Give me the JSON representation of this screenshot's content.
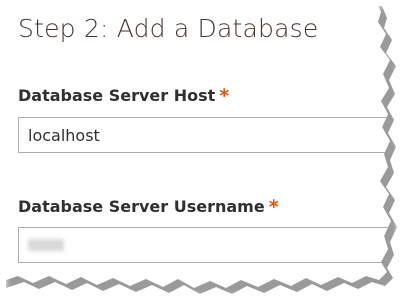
{
  "step_title": "Step 2: Add a Database",
  "fields": {
    "host": {
      "label": "Database Server Host",
      "required_marker": "*",
      "value": "localhost"
    },
    "username": {
      "label": "Database Server Username",
      "required_marker": "*",
      "value": ""
    }
  },
  "colors": {
    "required": "#eb5202",
    "title": "#41362f",
    "label": "#303030",
    "border": "#adadad"
  }
}
